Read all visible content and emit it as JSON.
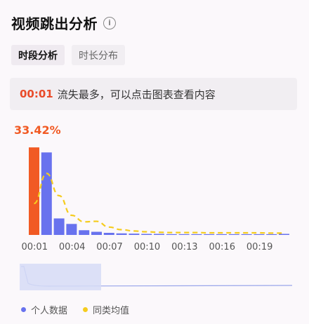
{
  "header": {
    "title": "视频跳出分析",
    "info_icon": "info-icon"
  },
  "tabs": [
    {
      "label": "时段分析",
      "active": true
    },
    {
      "label": "时长分布",
      "active": false
    }
  ],
  "notice": {
    "timestamp": "00:01",
    "text": "流失最多，可以点击图表查看内容"
  },
  "peak_label": "33.42%",
  "legend": {
    "personal": "个人数据",
    "average": "同类均值"
  },
  "colors": {
    "highlight": "#f15a24",
    "personal": "#6872ee",
    "average": "#f5cc1e",
    "text_red": "#e94b2a"
  },
  "chart_data": {
    "type": "bar",
    "categories": [
      "00:01",
      "00:02",
      "00:03",
      "00:04",
      "00:05",
      "00:06",
      "00:07",
      "00:08",
      "00:09",
      "00:10",
      "00:11",
      "00:12",
      "00:13",
      "00:14",
      "00:15",
      "00:16",
      "00:17",
      "00:18",
      "00:19",
      "00:20",
      "00:21"
    ],
    "x_tick_labels": [
      "00:01",
      "00:04",
      "00:07",
      "00:10",
      "00:13",
      "00:16",
      "00:19"
    ],
    "series": [
      {
        "name": "个人数据",
        "type": "bar",
        "values": [
          33.42,
          31.5,
          6.3,
          4.2,
          1.8,
          1.2,
          0.8,
          0.6,
          0.5,
          0.4,
          0.4,
          0.3,
          0.3,
          0.3,
          0.3,
          0.3,
          0.3,
          0.3,
          0.3,
          0.3,
          0.4
        ],
        "highlight_index": 0
      },
      {
        "name": "同类均值",
        "type": "line",
        "style": "dashed",
        "values": [
          12.0,
          23.5,
          15.0,
          7.5,
          5.0,
          5.2,
          3.0,
          2.0,
          1.5,
          1.2,
          1.0,
          0.9,
          0.9,
          0.9,
          0.8,
          0.8,
          0.8,
          0.8,
          0.8,
          0.7,
          0.7
        ]
      }
    ],
    "ylim": [
      0,
      34
    ]
  }
}
